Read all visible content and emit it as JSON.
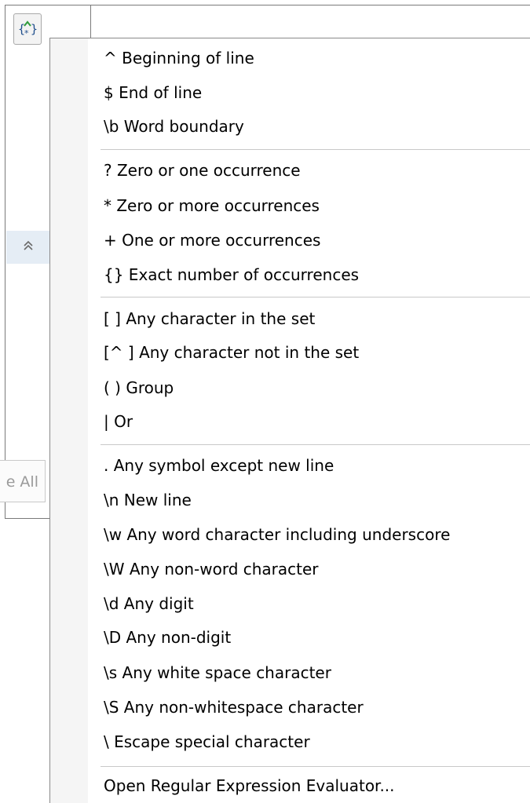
{
  "background": {
    "regex_button_icon": "regex-icon",
    "collapse_icon": "double-chevron-up-icon",
    "collapse_glyph": "≈",
    "partial_button_label": "e All"
  },
  "menu": {
    "groups": [
      {
        "items": [
          {
            "label": "^ Beginning of line"
          },
          {
            "label": "$ End of line"
          },
          {
            "label": "\\b Word boundary"
          }
        ]
      },
      {
        "items": [
          {
            "label": "? Zero or one occurrence"
          },
          {
            "label": "* Zero or more occurrences"
          },
          {
            "label": "+ One or more occurrences"
          },
          {
            "label": "{} Exact number of occurrences"
          }
        ]
      },
      {
        "items": [
          {
            "label": "[ ] Any character in the set"
          },
          {
            "label": "[^ ] Any character not in the set"
          },
          {
            "label": "( ) Group"
          },
          {
            "label": "| Or"
          }
        ]
      },
      {
        "items": [
          {
            "label": ". Any symbol except new line"
          },
          {
            "label": "\\n New line"
          },
          {
            "label": "\\w Any word character including underscore"
          },
          {
            "label": "\\W Any non-word character"
          },
          {
            "label": "\\d Any digit"
          },
          {
            "label": "\\D Any non-digit"
          },
          {
            "label": "\\s Any white space character"
          },
          {
            "label": "\\S Any non-whitespace character"
          },
          {
            "label": "\\ Escape special character"
          }
        ]
      },
      {
        "items": [
          {
            "label": "Open Regular Expression Evaluator..."
          }
        ]
      }
    ]
  }
}
